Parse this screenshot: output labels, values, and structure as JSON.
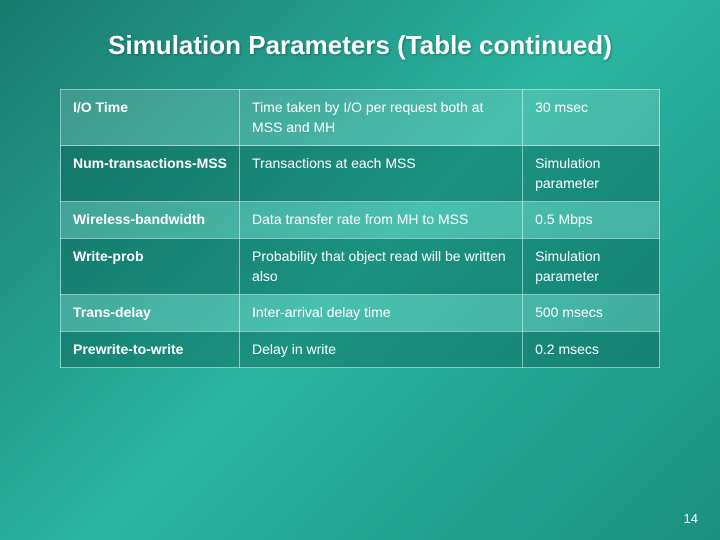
{
  "slide": {
    "title": "Simulation Parameters (Table continued)",
    "table": {
      "rows": [
        {
          "col1": "I/O Time",
          "col2": "Time taken by I/O per request both at MSS and MH",
          "col3": "30 msec"
        },
        {
          "col1": "Num-transactions-MSS",
          "col2": "Transactions at each MSS",
          "col3": "Simulation parameter"
        },
        {
          "col1": "Wireless-bandwidth",
          "col2": "Data transfer rate from MH to MSS",
          "col3": "0.5 Mbps"
        },
        {
          "col1": "Write-prob",
          "col2": "Probability that object read will be written also",
          "col3": "Simulation parameter"
        },
        {
          "col1": "Trans-delay",
          "col2": "Inter-arrival delay time",
          "col3": "500 msecs"
        },
        {
          "col1": "Prewrite-to-write",
          "col2": "Delay in write",
          "col3": "0.2 msecs"
        }
      ]
    },
    "page_number": "14"
  }
}
